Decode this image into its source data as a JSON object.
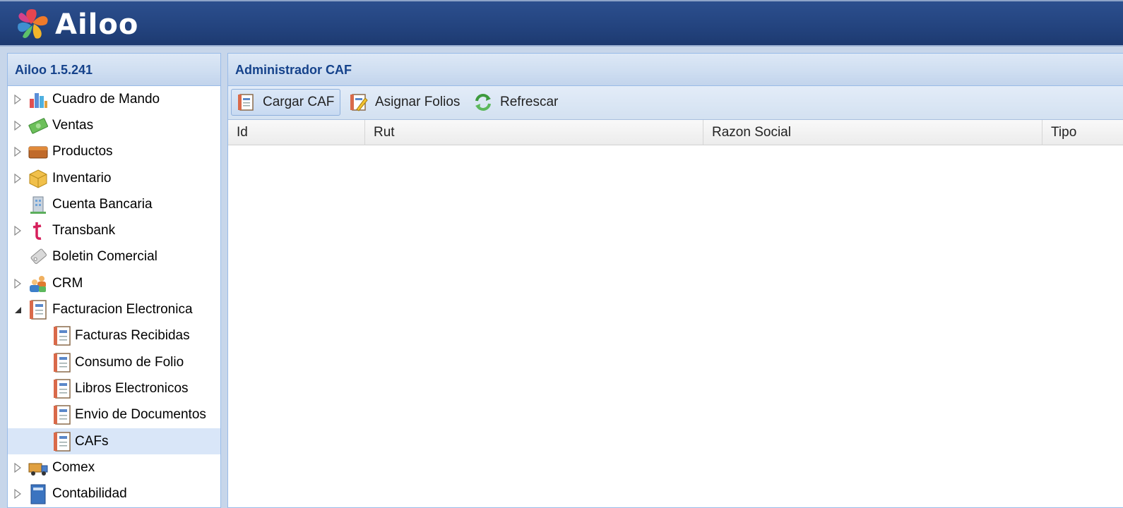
{
  "app": {
    "brand": "Ailoo"
  },
  "sidebar": {
    "title": "Ailoo 1.5.241",
    "items": [
      {
        "label": "Cuadro de Mando",
        "icon": "chart-icon",
        "expander": "collapsed"
      },
      {
        "label": "Ventas",
        "icon": "money-icon",
        "expander": "collapsed"
      },
      {
        "label": "Productos",
        "icon": "box-icon",
        "expander": "collapsed"
      },
      {
        "label": "Inventario",
        "icon": "package-icon",
        "expander": "collapsed"
      },
      {
        "label": "Cuenta Bancaria",
        "icon": "bank-icon",
        "expander": "none"
      },
      {
        "label": "Transbank",
        "icon": "transbank-icon",
        "expander": "collapsed"
      },
      {
        "label": "Boletin Comercial",
        "icon": "tag-icon",
        "expander": "none"
      },
      {
        "label": "CRM",
        "icon": "users-icon",
        "expander": "collapsed"
      },
      {
        "label": "Facturacion Electronica",
        "icon": "document-icon",
        "expander": "expanded"
      },
      {
        "label": "Facturas Recibidas",
        "icon": "document-icon"
      },
      {
        "label": "Consumo de Folio",
        "icon": "document-icon"
      },
      {
        "label": "Libros Electronicos",
        "icon": "document-icon"
      },
      {
        "label": "Envio de Documentos",
        "icon": "document-icon"
      },
      {
        "label": "CAFs",
        "icon": "document-icon",
        "selected": true
      },
      {
        "label": "Comex",
        "icon": "truck-icon",
        "expander": "collapsed"
      },
      {
        "label": "Contabilidad",
        "icon": "ledger-icon",
        "expander": "collapsed"
      }
    ]
  },
  "main": {
    "title": "Administrador CAF",
    "toolbar": {
      "cargar_caf": "Cargar CAF",
      "asignar_folios": "Asignar Folios",
      "refrescar": "Refrescar"
    },
    "columns": [
      "Id",
      "Rut",
      "Razon Social",
      "Tipo"
    ]
  }
}
